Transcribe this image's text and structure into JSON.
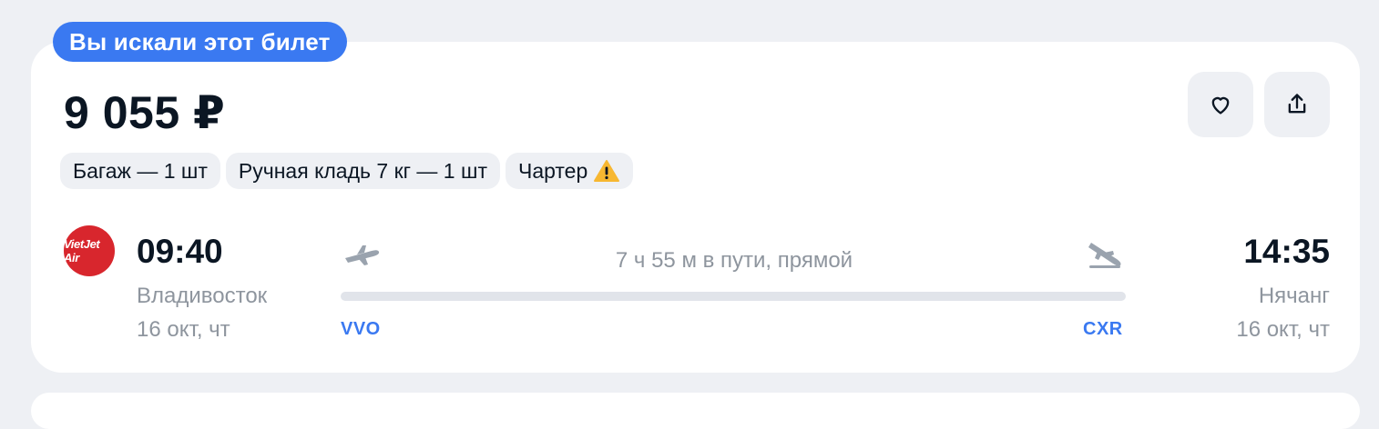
{
  "badge": "Вы искали этот билет",
  "price": "9 055 ₽",
  "tags": [
    {
      "label": "Багаж — 1 шт"
    },
    {
      "label": "Ручная кладь 7 кг — 1 шт"
    },
    {
      "label": "Чартер",
      "icon": "warning-icon"
    }
  ],
  "airline": {
    "logo_text": "VietJet Air",
    "color": "#d8262d"
  },
  "departure": {
    "time": "09:40",
    "city": "Владивосток",
    "date": "16 окт, чт",
    "code": "VVO"
  },
  "arrival": {
    "time": "14:35",
    "city": "Нячанг",
    "date": "16 окт, чт",
    "code": "CXR"
  },
  "duration": "7 ч 55 м в пути, прямой",
  "actions": {
    "favorite_icon": "heart-icon",
    "share_icon": "share-icon"
  },
  "colors": {
    "accent": "#3a79f1",
    "background": "#eef0f4",
    "warning": "#f7b731"
  }
}
